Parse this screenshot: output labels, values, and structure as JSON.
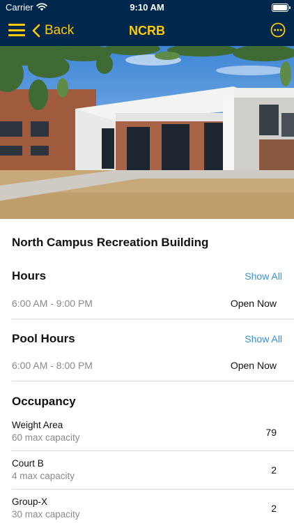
{
  "status_bar": {
    "carrier": "Carrier",
    "time": "9:10 AM"
  },
  "nav": {
    "back_label": "Back",
    "title": "NCRB"
  },
  "building": {
    "name": "North Campus Recreation Building"
  },
  "hours": {
    "title": "Hours",
    "show_all": "Show All",
    "range": "6:00 AM - 9:00 PM",
    "status": "Open Now"
  },
  "pool_hours": {
    "title": "Pool Hours",
    "show_all": "Show All",
    "range": "6:00 AM - 8:00 PM",
    "status": "Open Now"
  },
  "occupancy": {
    "title": "Occupancy",
    "items": [
      {
        "name": "Weight Area",
        "capacity": "60 max capacity",
        "count": "79"
      },
      {
        "name": "Court B",
        "capacity": "4 max capacity",
        "count": "2"
      },
      {
        "name": "Group-X",
        "capacity": "30 max capacity",
        "count": "2"
      }
    ]
  },
  "colors": {
    "nav_background": "#00274c",
    "accent": "#ffcb05",
    "link": "#3a8fd8"
  },
  "icons": [
    "menu-icon",
    "chevron-left-icon",
    "more-icon",
    "wifi-icon",
    "battery-icon"
  ]
}
